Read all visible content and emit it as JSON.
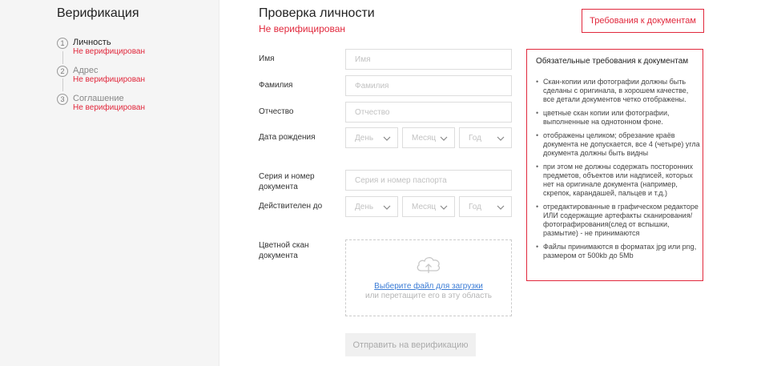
{
  "sidebar": {
    "title": "Верификация",
    "steps": [
      {
        "num": "1",
        "label": "Личность",
        "status": "Не верифицирован"
      },
      {
        "num": "2",
        "label": "Адрес",
        "status": "Не верифицирован"
      },
      {
        "num": "3",
        "label": "Соглашение",
        "status": "Не верифицирован"
      }
    ]
  },
  "main": {
    "title": "Проверка личности",
    "status": "Не верифицирован",
    "requirements_button": "Требования к документам",
    "fields": {
      "first_name": {
        "label": "Имя",
        "placeholder": "Имя"
      },
      "last_name": {
        "label": "Фамилия",
        "placeholder": "Фамилия"
      },
      "patronymic": {
        "label": "Отчество",
        "placeholder": "Отчество"
      },
      "birth_date": {
        "label": "Дата рождения",
        "day": "День",
        "month": "Месяц",
        "year": "Год"
      },
      "document": {
        "label": "Серия и номер документа",
        "placeholder": "Серия и номер паспорта"
      },
      "valid_until": {
        "label": "Действителен до",
        "day": "День",
        "month": "Месяц",
        "year": "Год"
      },
      "scan": {
        "label": "Цветной скан документа"
      }
    },
    "upload": {
      "link": "Выберите файл для загрузки",
      "hint": "или перетащите его в эту область"
    },
    "submit": "Отправить на верификацию"
  },
  "requirements": {
    "title": "Обязательные требования к документам",
    "items": [
      "Скан-копии или фотографии должны быть сделаны с оригинала, в хорошем качестве, все детали документов четко отображены.",
      "цветные скан копии или фотографии, выполненные на однотонном фоне.",
      "отображены целиком; обрезание краёв документа не допускается, все 4 (четыре) угла документа должны быть видны",
      "при этом не должны содержать посторонних предметов, объектов или надписей, которых нет на оригинале документа (например, скрепок, карандашей, пальцев и т.д.)",
      "отредактированные в графическом редакторе ИЛИ содержащие артефакты сканирования/фотографирования(след от вспышки, размытие) - не принимаются",
      "Файлы принимаются в форматах jpg или png, размером от 500kb до 5Mb"
    ]
  },
  "colors": {
    "accent": "#e1283c",
    "link": "#3a7bd5",
    "sidebar_bg": "#f5f5f5"
  }
}
